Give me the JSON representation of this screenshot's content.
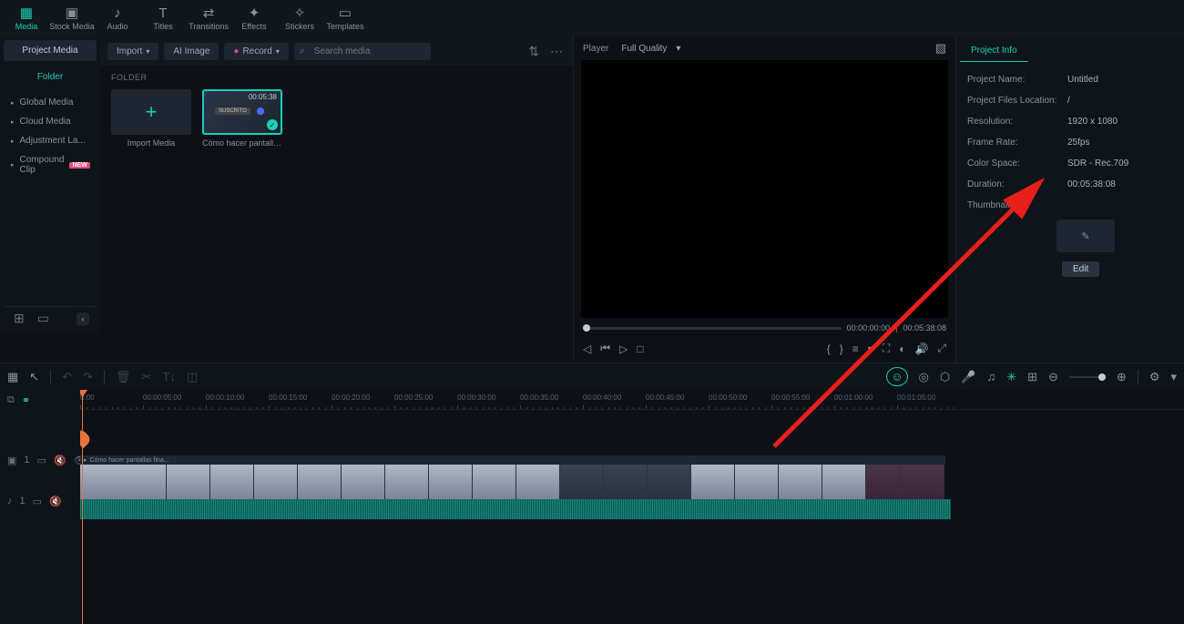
{
  "nav": {
    "tabs": [
      {
        "label": "Media",
        "icon": "▦"
      },
      {
        "label": "Stock Media",
        "icon": "▣"
      },
      {
        "label": "Audio",
        "icon": "♪"
      },
      {
        "label": "Titles",
        "icon": "T"
      },
      {
        "label": "Transitions",
        "icon": "⇄"
      },
      {
        "label": "Effects",
        "icon": "✦"
      },
      {
        "label": "Stickers",
        "icon": "✧"
      },
      {
        "label": "Templates",
        "icon": "▭"
      }
    ]
  },
  "left_toolbar": {
    "import": "Import",
    "ai_image": "AI Image",
    "record": "Record",
    "search_placeholder": "Search media"
  },
  "sidebar": {
    "project_media": "Project Media",
    "folder": "Folder",
    "items": [
      "Global Media",
      "Cloud Media",
      "Adjustment La...",
      "Compound Clip"
    ],
    "new_badge": "NEW"
  },
  "media": {
    "folder_label": "FOLDER",
    "import_label": "Import Media",
    "clip": {
      "duration": "00:05:38",
      "name": "Cómo hacer pantallas ...",
      "tag": "SUSCRITO"
    }
  },
  "player": {
    "title": "Player",
    "quality": "Full Quality",
    "time_current": "00:00:00:00",
    "time_total": "00:05:38:08"
  },
  "info": {
    "tab": "Project Info",
    "rows": [
      {
        "label": "Project Name:",
        "value": "Untitled"
      },
      {
        "label": "Project Files Location:",
        "value": "/"
      },
      {
        "label": "Resolution:",
        "value": "1920 x 1080"
      },
      {
        "label": "Frame Rate:",
        "value": "25fps"
      },
      {
        "label": "Color Space:",
        "value": "SDR - Rec.709"
      },
      {
        "label": "Duration:",
        "value": "00:05:38:08"
      },
      {
        "label": "Thumbnail:",
        "value": ""
      }
    ],
    "edit": "Edit"
  },
  "timeline": {
    "ticks": [
      "0:00",
      "00:00:05:00",
      "00:00:10:00",
      "00:00:15:00",
      "00:00:20:00",
      "00:00:25:00",
      "00:00:30:00",
      "00:00:35:00",
      "00:00:40:00",
      "00:00:45:00",
      "00:00:50:00",
      "00:00:55:00",
      "00:01:00:00",
      "00:01:05:00"
    ],
    "clip_title": "Cómo hacer pantallas fina..."
  }
}
